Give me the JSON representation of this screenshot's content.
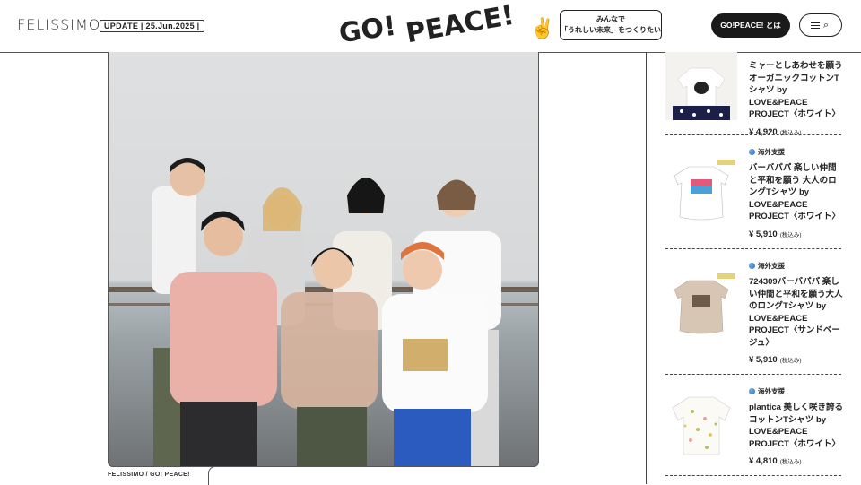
{
  "header": {
    "logo": "FELISSIMO",
    "update_label": "UPDATE | 25.Jun.2025 |",
    "title_go": "GO!",
    "title_peace": "PEACE!",
    "tagline_line1": "みんなで",
    "tagline_line2": "「うれしい未来」をつくりたい",
    "about_button": "GO!PEACE! とは"
  },
  "photo": {
    "credit": "FELISSIMO / GO! PEACE!"
  },
  "products": [
    {
      "category": "",
      "name": "ミャーとしあわせを願うオーガニックコットンTシャツ by LOVE&PEACE PROJECT〈ホワイト〉",
      "price": "¥ 4,920",
      "tax": "(税込み)"
    },
    {
      "category": "海外支援",
      "name": "バーバパパ 楽しい仲間と平和を願う 大人のロングTシャツ by LOVE&PEACE PROJECT〈ホワイト〉",
      "price": "¥ 5,910",
      "tax": "(税込み)"
    },
    {
      "category": "海外支援",
      "name": "724309バーバパパ 楽しい仲間と平和を願う大人のロングTシャツ by LOVE&PEACE PROJECT〈サンドベージュ〉",
      "price": "¥ 5,910",
      "tax": "(税込み)"
    },
    {
      "category": "海外支援",
      "name": "plantica 美しく咲き誇るコットンTシャツ by LOVE&PEACE PROJECT〈ホワイト〉",
      "price": "¥ 4,810",
      "tax": "(税込み)"
    }
  ],
  "colors": {
    "accent": "#1a1a1a",
    "globe": "#2e6db3"
  }
}
